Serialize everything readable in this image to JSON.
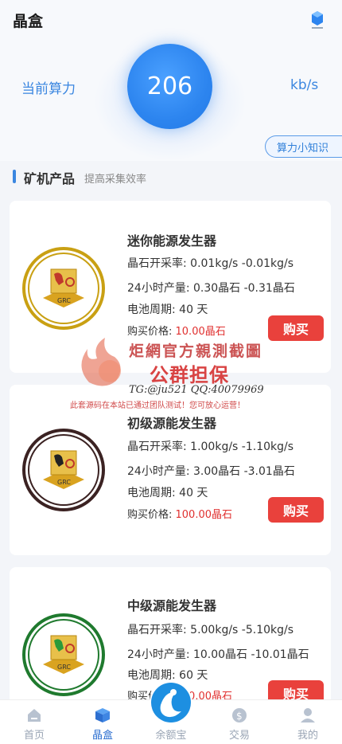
{
  "header": {
    "title": "晶盒"
  },
  "hero": {
    "label": "当前算力",
    "value": "206",
    "unit": "kb/s",
    "knowledge_button": "算力小知识"
  },
  "section": {
    "title": "矿机产品",
    "subtitle": "提高采集效率"
  },
  "products": [
    {
      "name": "迷你能源发生器",
      "rate": "晶石开采率: 0.01kg/s -0.01kg/s",
      "output": "24小时产量: 0.30晶石 -0.31晶石",
      "cycle": "电池周期: 40 天",
      "price_label": "购买价格: ",
      "price_value": "10.00晶石",
      "buy_label": "购买",
      "ring_color": "#c9a013",
      "logo_text": "GRC"
    },
    {
      "name": "初级源能发生器",
      "rate": "晶石开采率: 1.00kg/s -1.10kg/s",
      "output": "24小时产量: 3.00晶石 -3.01晶石",
      "cycle": "电池周期: 40 天",
      "price_label": "购买价格: ",
      "price_value": "100.00晶石",
      "buy_label": "购买",
      "ring_color": "#3b2222",
      "logo_text": "GRC"
    },
    {
      "name": "中级源能发生器",
      "rate": "晶石开采率: 5.00kg/s -5.10kg/s",
      "output": "24小时产量: 10.00晶石 -10.01晶石",
      "cycle": "电池周期: 60 天",
      "price_label": "购买价格: ",
      "price_value": "500.00晶石",
      "buy_label": "购买",
      "ring_color": "#1f7a2e",
      "logo_text": "GRC"
    }
  ],
  "watermark": {
    "line1": "炬網官方親測截圖",
    "line2": "公群担保",
    "line3": "TG:@ju521   QQ:40079969",
    "line4": "此套源码在本站已通过团队测试！您可放心运营！"
  },
  "tabs": [
    {
      "label": "首页",
      "icon": "home-icon",
      "active": false
    },
    {
      "label": "晶盒",
      "icon": "cube-icon",
      "active": true
    },
    {
      "label": "余额宝",
      "icon": "balance-icon",
      "active": false
    },
    {
      "label": "交易",
      "icon": "dollar-icon",
      "active": false
    },
    {
      "label": "我的",
      "icon": "user-icon",
      "active": false
    }
  ],
  "colors": {
    "accent": "#2d85ef",
    "buy": "#e9413c",
    "price": "#e0302f"
  }
}
